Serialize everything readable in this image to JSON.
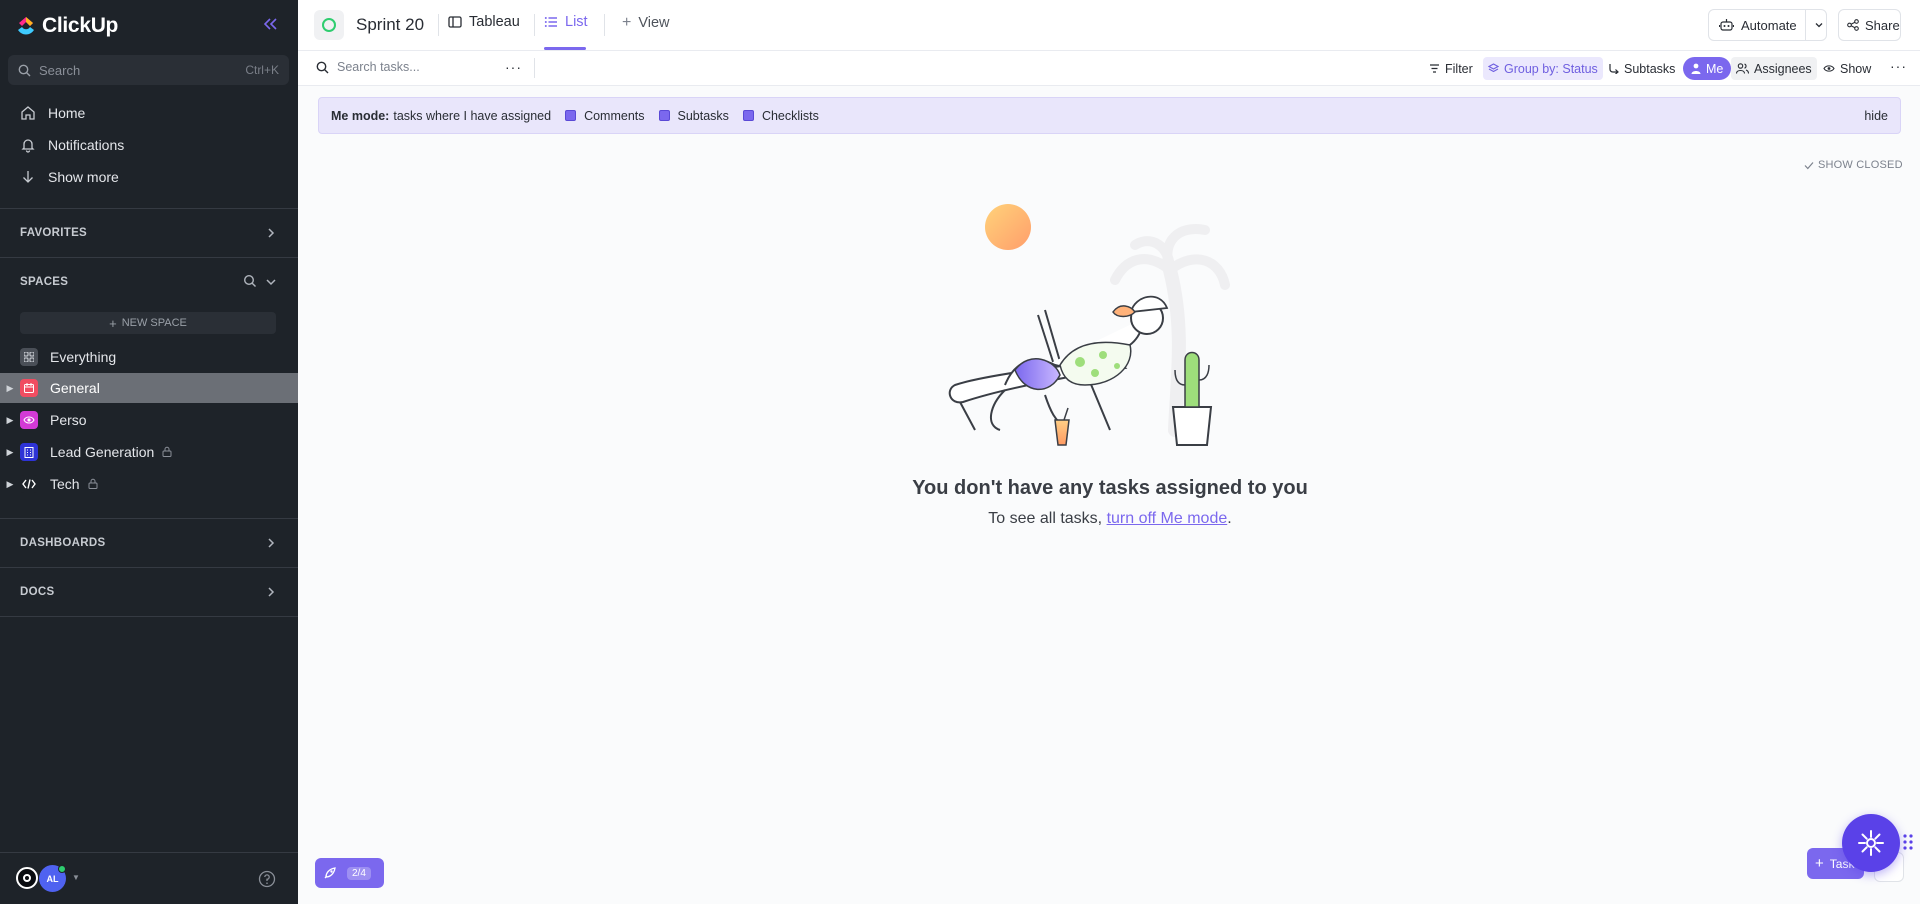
{
  "sidebar": {
    "app_name": "ClickUp",
    "search": {
      "placeholder": "Search",
      "shortcut": "Ctrl+K"
    },
    "nav": [
      {
        "label": "Home",
        "icon": "home-icon"
      },
      {
        "label": "Notifications",
        "icon": "bell-icon"
      },
      {
        "label": "Show more",
        "icon": "arrow-down-icon"
      }
    ],
    "sections": {
      "favorites": "FAVORITES",
      "spaces": "SPACES",
      "dashboards": "DASHBOARDS",
      "docs": "DOCS"
    },
    "new_space": "NEW SPACE",
    "spaces": [
      {
        "label": "Everything",
        "icon": "grid-icon",
        "color": "#4a4f57"
      },
      {
        "label": "General",
        "icon": "calendar-icon",
        "color": "#f04d61",
        "active": true
      },
      {
        "label": "Perso",
        "icon": "eye-icon",
        "color": "#d33ad6"
      },
      {
        "label": "Lead Generation",
        "icon": "building-icon",
        "color": "#2e33d6",
        "locked": true
      },
      {
        "label": "Tech",
        "icon": "code-icon",
        "color": "#1e2329",
        "locked": true
      }
    ],
    "user_initials": "AL"
  },
  "header": {
    "list_name": "Sprint 20",
    "tabs": [
      {
        "label": "Tableau"
      },
      {
        "label": "List",
        "active": true
      },
      {
        "label": "View"
      }
    ],
    "automate": "Automate",
    "share": "Share"
  },
  "toolbar": {
    "search_placeholder": "Search tasks...",
    "filter": "Filter",
    "group_by": "Group by: Status",
    "subtasks": "Subtasks",
    "me": "Me",
    "assignees": "Assignees",
    "show": "Show"
  },
  "banner": {
    "bold": "Me mode:",
    "text": "tasks where I have assigned",
    "options": [
      "Comments",
      "Subtasks",
      "Checklists"
    ],
    "hide": "hide"
  },
  "show_closed": "SHOW CLOSED",
  "empty_state": {
    "title": "You don't have any tasks assigned to you",
    "sub_prefix": "To see all tasks,",
    "link": "turn off Me mode",
    "sub_suffix": "."
  },
  "bottom": {
    "onboarding_progress": "2/4",
    "task_button": "Task"
  },
  "colors": {
    "accent": "#7b68ee",
    "sidebar_bg": "#1e2329"
  }
}
